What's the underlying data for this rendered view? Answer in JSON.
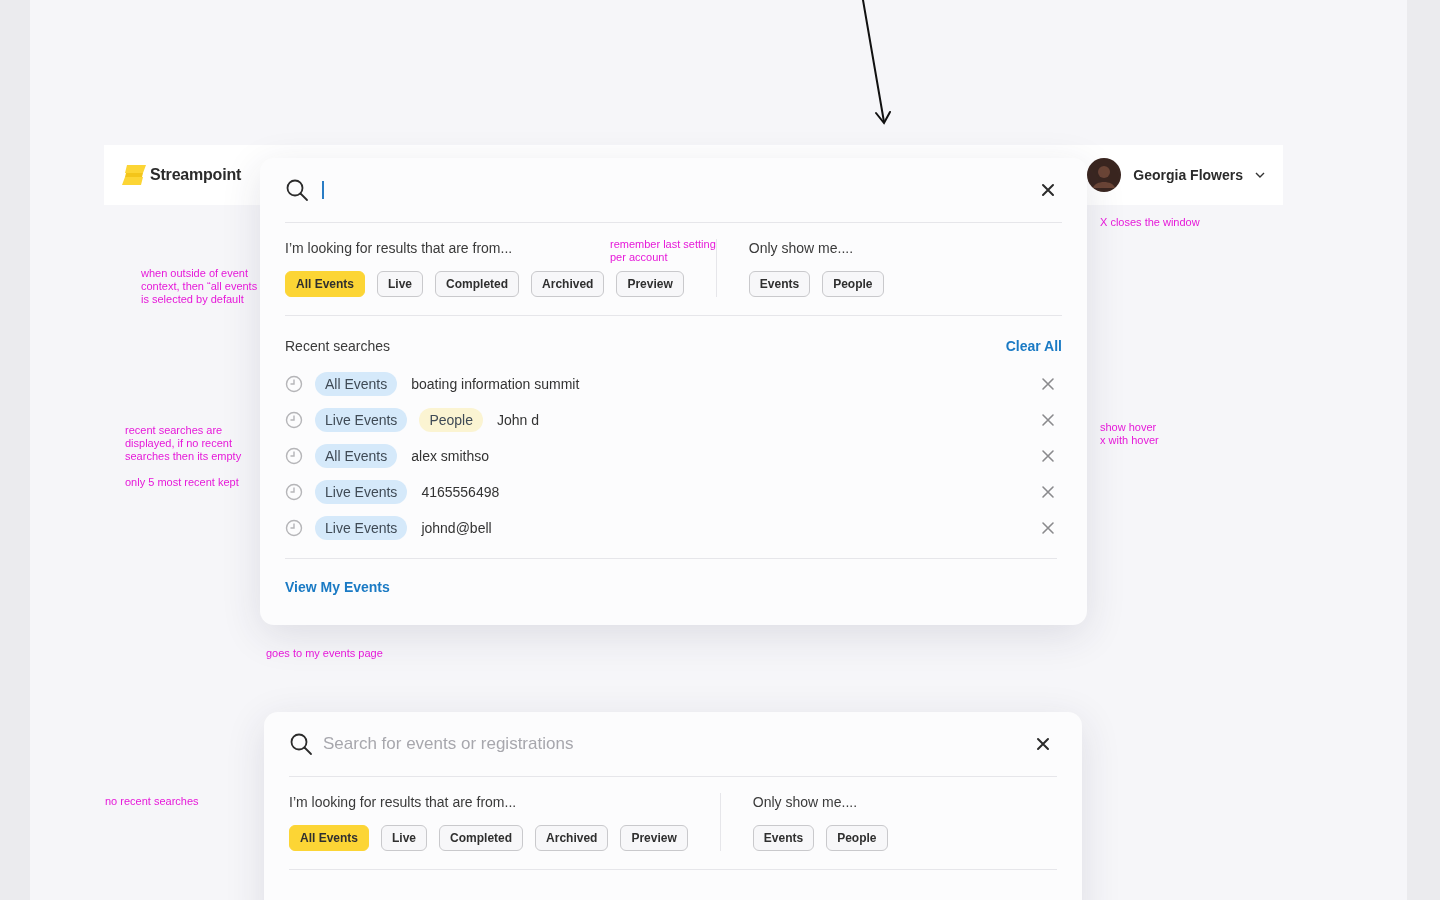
{
  "header": {
    "logo": "Streampoint",
    "user_name": "Georgia Flowers"
  },
  "panels": [
    {
      "focused": true,
      "from_label": "I’m looking for results that are from...",
      "from_options": [
        {
          "label": "All Events",
          "selected": true
        },
        {
          "label": "Live",
          "selected": false
        },
        {
          "label": "Completed",
          "selected": false
        },
        {
          "label": "Archived",
          "selected": false
        },
        {
          "label": "Preview",
          "selected": false
        }
      ],
      "show_label": "Only show me....",
      "show_options": [
        {
          "label": "Events",
          "selected": false
        },
        {
          "label": "People",
          "selected": false
        }
      ],
      "recent": {
        "title": "Recent searches",
        "clear_label": "Clear All",
        "items": [
          {
            "tags": [
              {
                "label": "All Events",
                "kind": "scope"
              }
            ],
            "query": "boating information summit"
          },
          {
            "tags": [
              {
                "label": "Live Events",
                "kind": "scope"
              },
              {
                "label": "People",
                "kind": "type"
              }
            ],
            "query": "John d"
          },
          {
            "tags": [
              {
                "label": "All Events",
                "kind": "scope"
              }
            ],
            "query": "alex smithso"
          },
          {
            "tags": [
              {
                "label": "Live Events",
                "kind": "scope"
              }
            ],
            "query": "4165556498"
          },
          {
            "tags": [
              {
                "label": "Live Events",
                "kind": "scope"
              }
            ],
            "query": "johnd@bell"
          }
        ]
      },
      "footer_link": "View My Events"
    },
    {
      "focused": false,
      "placeholder": "Search for events or registrations",
      "from_label": "I’m looking for results that are from...",
      "from_options": [
        {
          "label": "All Events",
          "selected": true
        },
        {
          "label": "Live",
          "selected": false
        },
        {
          "label": "Completed",
          "selected": false
        },
        {
          "label": "Archived",
          "selected": false
        },
        {
          "label": "Preview",
          "selected": false
        }
      ],
      "show_label": "Only show me....",
      "show_options": [
        {
          "label": "Events",
          "selected": false
        },
        {
          "label": "People",
          "selected": false
        }
      ]
    }
  ],
  "annotations": [
    {
      "text": "X closes the window"
    },
    {
      "text": "remember last setting\nper account"
    },
    {
      "text": "when outside of event\ncontext, then “all events\nis selected by default"
    },
    {
      "text": "recent searches are\ndisplayed, if no recent\nsearches then its empty"
    },
    {
      "text": "only 5 most recent kept"
    },
    {
      "text": "show hover\nx with hover"
    },
    {
      "text": "goes to my events page"
    },
    {
      "text": "no recent searches"
    }
  ]
}
